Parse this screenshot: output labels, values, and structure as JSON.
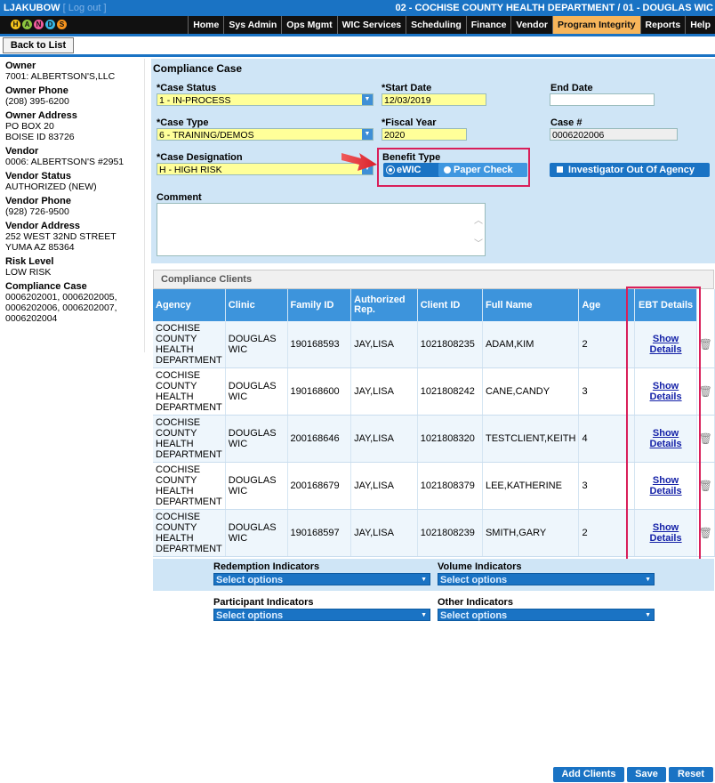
{
  "topbar": {
    "user": "LJAKUBOW",
    "logout": "[ Log out ]",
    "department": "02 - COCHISE COUNTY HEALTH DEPARTMENT / 01 - DOUGLAS WIC"
  },
  "logo_letters": [
    "H",
    "A",
    "N",
    "D",
    "S"
  ],
  "nav": [
    "Home",
    "Sys Admin",
    "Ops Mgmt",
    "WIC Services",
    "Scheduling",
    "Finance",
    "Vendor",
    "Program Integrity",
    "Reports",
    "Help"
  ],
  "back_label": "Back to List",
  "sidebar": [
    {
      "label": "Owner",
      "value": "7001: ALBERTSON'S,LLC"
    },
    {
      "label": "Owner Phone",
      "value": "(208) 395-6200"
    },
    {
      "label": "Owner Address",
      "value": "PO BOX 20\nBOISE ID 83726"
    },
    {
      "label": "Vendor",
      "value": "0006: ALBERTSON'S #2951"
    },
    {
      "label": "Vendor Status",
      "value": "AUTHORIZED (NEW)"
    },
    {
      "label": "Vendor Phone",
      "value": "(928) 726-9500"
    },
    {
      "label": "Vendor Address",
      "value": "252 WEST 32ND STREET\nYUMA AZ 85364"
    },
    {
      "label": "Risk Level",
      "value": "LOW RISK"
    },
    {
      "label": "Compliance Case",
      "value": "0006202001, 0006202005,\n0006202006, 0006202007,\n0006202004"
    }
  ],
  "form": {
    "title": "Compliance Case",
    "case_status_label": "*Case Status",
    "case_status": "1 - IN-PROCESS",
    "start_date_label": "*Start Date",
    "start_date": "12/03/2019",
    "end_date_label": "End Date",
    "end_date": "",
    "case_type_label": "*Case Type",
    "case_type": "6 - TRAINING/DEMOS",
    "fiscal_year_label": "*Fiscal Year",
    "fiscal_year": "2020",
    "case_no_label": "Case #",
    "case_no": "0006202006",
    "designation_label": "*Case Designation",
    "designation": "H - HIGH RISK",
    "benefit_type_label": "Benefit Type",
    "benefit_options": [
      "eWIC",
      "Paper Check"
    ],
    "benefit_selected": "eWIC",
    "investigator_label": "Investigator Out Of Agency",
    "comment_label": "Comment",
    "comment": ""
  },
  "clients": {
    "title": "Compliance Clients",
    "columns": [
      "Agency",
      "Clinic",
      "Family ID",
      "Authorized Rep.",
      "Client ID",
      "Full Name",
      "Age",
      "EBT Details"
    ],
    "rows": [
      {
        "agency": "COCHISE COUNTY HEALTH DEPARTMENT",
        "clinic": "DOUGLAS WIC",
        "family_id": "190168593",
        "auth_rep": "JAY,LISA",
        "client_id": "1021808235",
        "full_name": "ADAM,KIM",
        "age": "2",
        "details": "Show Details"
      },
      {
        "agency": "COCHISE COUNTY HEALTH DEPARTMENT",
        "clinic": "DOUGLAS WIC",
        "family_id": "190168600",
        "auth_rep": "JAY,LISA",
        "client_id": "1021808242",
        "full_name": "CANE,CANDY",
        "age": "3",
        "details": "Show Details"
      },
      {
        "agency": "COCHISE COUNTY HEALTH DEPARTMENT",
        "clinic": "DOUGLAS WIC",
        "family_id": "200168646",
        "auth_rep": "JAY,LISA",
        "client_id": "1021808320",
        "full_name": "TESTCLIENT,KEITH",
        "age": "4",
        "details": "Show Details"
      },
      {
        "agency": "COCHISE COUNTY HEALTH DEPARTMENT",
        "clinic": "DOUGLAS WIC",
        "family_id": "200168679",
        "auth_rep": "JAY,LISA",
        "client_id": "1021808379",
        "full_name": "LEE,KATHERINE",
        "age": "3",
        "details": "Show Details"
      },
      {
        "agency": "COCHISE COUNTY HEALTH DEPARTMENT",
        "clinic": "DOUGLAS WIC",
        "family_id": "190168597",
        "auth_rep": "JAY,LISA",
        "client_id": "1021808239",
        "full_name": "SMITH,GARY",
        "age": "2",
        "details": "Show Details"
      }
    ]
  },
  "indicators": {
    "redemption_label": "Redemption Indicators",
    "volume_label": "Volume Indicators",
    "participant_label": "Participant Indicators",
    "other_label": "Other Indicators",
    "placeholder": "Select options"
  },
  "footer": {
    "add_clients": "Add Clients",
    "save": "Save",
    "reset": "Reset"
  }
}
